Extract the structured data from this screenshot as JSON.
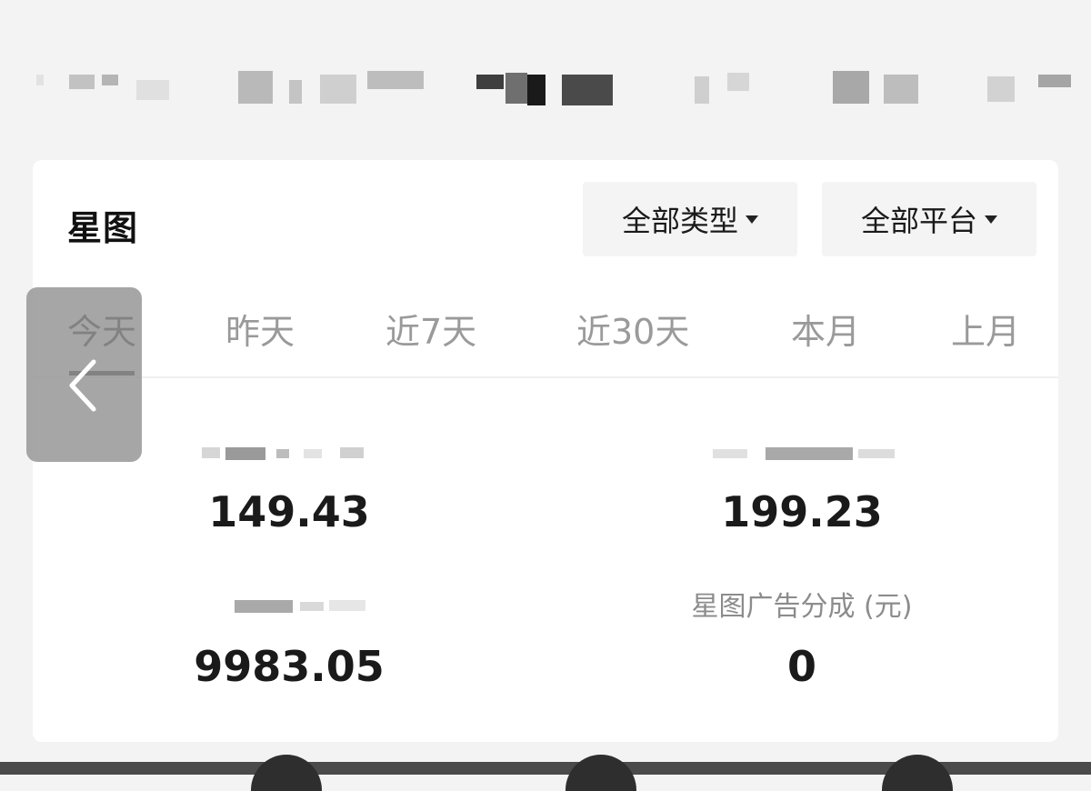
{
  "card": {
    "title": "星图",
    "filters": {
      "type_label": "全部类型",
      "platform_label": "全部平台"
    },
    "tabs": [
      {
        "label": "今天",
        "active": true
      },
      {
        "label": "昨天",
        "active": false
      },
      {
        "label": "近7天",
        "active": false
      },
      {
        "label": "近30天",
        "active": false
      },
      {
        "label": "本月",
        "active": false
      },
      {
        "label": "上月",
        "active": false
      }
    ],
    "stats": [
      {
        "label": "",
        "value": "149.43"
      },
      {
        "label": "",
        "value": "199.23"
      },
      {
        "label": "",
        "value": "9983.05"
      },
      {
        "label": "星图广告分成 (元)",
        "value": "0"
      }
    ]
  },
  "overlay": {
    "icon": "chevron-left-icon"
  },
  "colors": {
    "background": "#f3f3f3",
    "card": "#ffffff",
    "muted_text": "#9a9a9a",
    "overlay": "#969696"
  }
}
